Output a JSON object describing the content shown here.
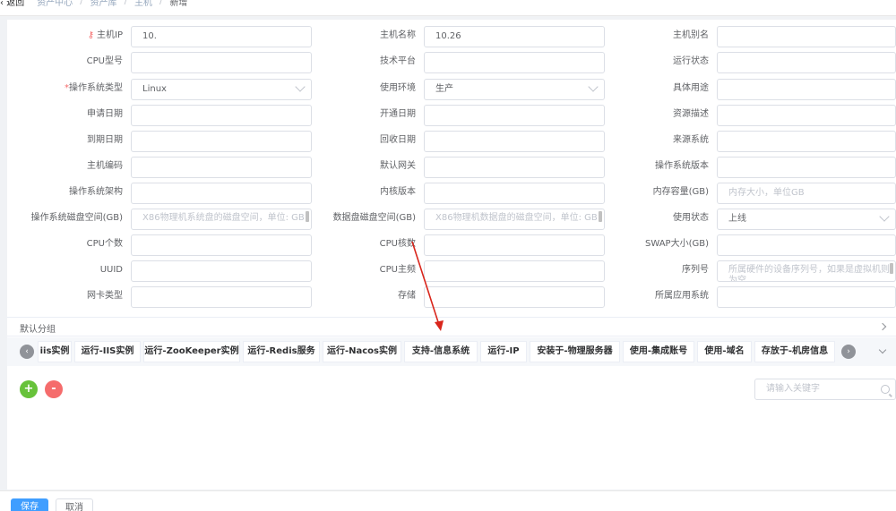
{
  "breadcrumb": {
    "back": "返回",
    "items": [
      "资产中心",
      "资产库",
      "主机",
      "新增"
    ]
  },
  "form": {
    "col1": [
      {
        "label": "主机IP",
        "value": "10.",
        "required": false,
        "key": true
      },
      {
        "label": "CPU型号",
        "value": ""
      },
      {
        "label": "操作系统类型",
        "value": "Linux",
        "required": true,
        "select": true
      },
      {
        "label": "申请日期",
        "value": ""
      },
      {
        "label": "到期日期",
        "value": ""
      },
      {
        "label": "主机编码",
        "value": ""
      },
      {
        "label": "操作系统架构",
        "value": ""
      },
      {
        "label": "操作系统磁盘空间(GB)",
        "placeholder": "X86物理机系统盘的磁盘空间，单位: GB",
        "textarea": true
      },
      {
        "label": "CPU个数",
        "value": ""
      },
      {
        "label": "UUID",
        "value": ""
      },
      {
        "label": "网卡类型",
        "value": ""
      }
    ],
    "col2": [
      {
        "label": "主机名称",
        "value": "10.26"
      },
      {
        "label": "技术平台",
        "value": ""
      },
      {
        "label": "使用环境",
        "value": "生产",
        "select": true
      },
      {
        "label": "开通日期",
        "value": ""
      },
      {
        "label": "回收日期",
        "value": ""
      },
      {
        "label": "默认网关",
        "value": ""
      },
      {
        "label": "内核版本",
        "value": ""
      },
      {
        "label": "数据盘磁盘空间(GB)",
        "placeholder": "X86物理机数据盘的磁盘空间，单位: GB",
        "textarea": true
      },
      {
        "label": "CPU核数",
        "value": ""
      },
      {
        "label": "CPU主频",
        "value": ""
      },
      {
        "label": "存储",
        "value": ""
      }
    ],
    "col3": [
      {
        "label": "主机别名",
        "value": ""
      },
      {
        "label": "运行状态",
        "value": ""
      },
      {
        "label": "具体用途",
        "value": ""
      },
      {
        "label": "资源描述",
        "value": ""
      },
      {
        "label": "来源系统",
        "value": ""
      },
      {
        "label": "操作系统版本",
        "value": ""
      },
      {
        "label": "内存容量(GB)",
        "placeholder": "内存大小，单位GB"
      },
      {
        "label": "使用状态",
        "value": "上线",
        "select": true
      },
      {
        "label": "SWAP大小(GB)",
        "value": ""
      },
      {
        "label": "序列号",
        "placeholder": "所属硬件的设备序列号，如果是虚拟机则为空",
        "textarea": true
      },
      {
        "label": "所属应用系统",
        "value": ""
      }
    ]
  },
  "group": {
    "title": "默认分组"
  },
  "tabs": [
    "iis实例",
    "运行-IIS实例",
    "运行-ZooKeeper实例",
    "运行-Redis服务",
    "运行-Nacos实例",
    "支持-信息系统",
    "运行-IP",
    "安装于-物理服务器",
    "使用-集成账号",
    "使用-域名",
    "存放于-机房信息"
  ],
  "toolbar": {
    "add": "+",
    "remove": "-",
    "search_placeholder": "请输入关键字"
  },
  "footer": {
    "save": "保存",
    "cancel": "取消"
  },
  "colors": {
    "primary": "#409eff",
    "success": "#67c23a",
    "danger": "#f56c6c",
    "annotation": "#d9261c"
  }
}
